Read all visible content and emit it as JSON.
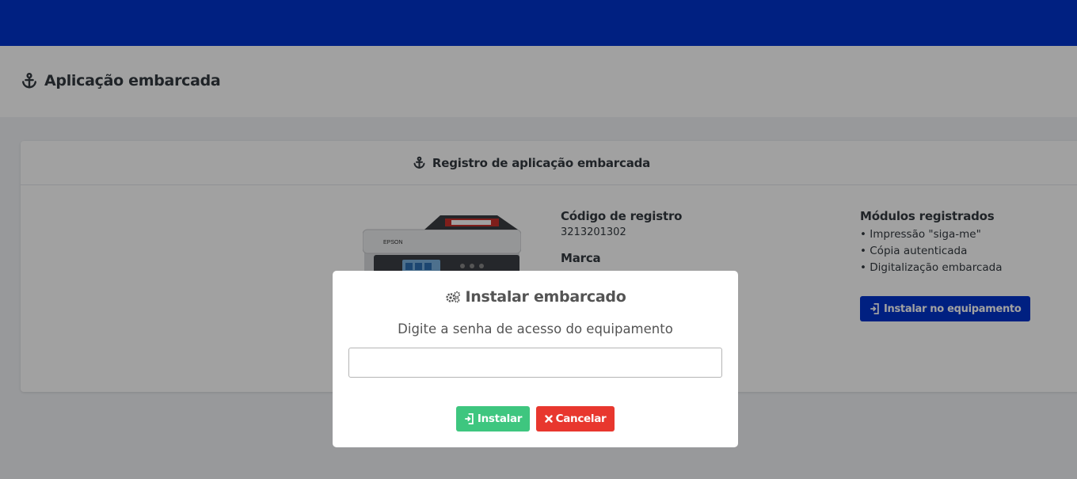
{
  "page": {
    "title": "Aplicação embarcada",
    "title_icon": "anchor-icon"
  },
  "card": {
    "header": "Registro de aplicação embarcada",
    "header_icon": "anchor-icon",
    "printer_brand_label": "EPSON",
    "registration_code_label": "Código de registro",
    "registration_code": "3213201302",
    "brand_label": "Marca",
    "modules_label": "Módulos registrados",
    "modules": [
      "• Impressão \"siga-me\"",
      "• Cópia autenticada",
      "• Digitalização embarcada"
    ],
    "install_equipment_button": "Instalar no equipamento"
  },
  "modal": {
    "title": "Instalar embarcado",
    "title_icon": "cogs-icon",
    "subtitle": "Digite a senha de acesso do equipamento",
    "password_value": "",
    "install_button": "Instalar",
    "cancel_button": "Cancelar"
  },
  "colors": {
    "topbar": "#0033cc",
    "primary": "#0033cc",
    "success": "#3ec67f",
    "danger": "#e8372e"
  }
}
